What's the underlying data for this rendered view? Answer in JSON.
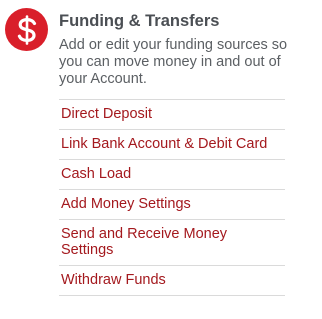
{
  "section": {
    "icon": "dollar-icon",
    "accent_color": "#d91f2a",
    "title": "Funding & Transfers",
    "description_lines": [
      "Add or edit your funding sources so",
      "you can move money in and out of",
      "your Account."
    ]
  },
  "links": [
    {
      "lines": [
        "Direct Deposit"
      ]
    },
    {
      "lines": [
        "Link Bank Account & Debit Card"
      ]
    },
    {
      "lines": [
        "Cash Load"
      ]
    },
    {
      "lines": [
        "Add Money Settings"
      ]
    },
    {
      "lines": [
        "Send and Receive Money",
        "Settings"
      ]
    },
    {
      "lines": [
        "Withdraw Funds"
      ]
    }
  ]
}
